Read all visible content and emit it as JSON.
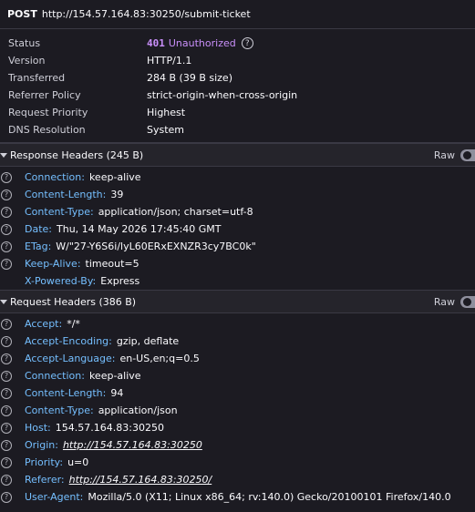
{
  "request": {
    "method": "POST",
    "url": "http://154.57.164.83:30250/submit-ticket"
  },
  "summary": [
    {
      "key": "Status",
      "code": "401",
      "text": "Unauthorized",
      "help": "?"
    },
    {
      "key": "Version",
      "value": "HTTP/1.1"
    },
    {
      "key": "Transferred",
      "value": "284 B (39 B size)"
    },
    {
      "key": "Referrer Policy",
      "value": "strict-origin-when-cross-origin"
    },
    {
      "key": "Request Priority",
      "value": "Highest"
    },
    {
      "key": "DNS Resolution",
      "value": "System"
    }
  ],
  "response_headers": {
    "title": "Response Headers (245 B)",
    "raw_label": "Raw",
    "items": [
      {
        "name": "Connection:",
        "value": "keep-alive",
        "help": true
      },
      {
        "name": "Content-Length:",
        "value": "39",
        "help": true
      },
      {
        "name": "Content-Type:",
        "value": "application/json; charset=utf-8",
        "help": true
      },
      {
        "name": "Date:",
        "value": "Thu, 14 May 2026 17:45:40 GMT",
        "help": true
      },
      {
        "name": "ETag:",
        "value": "W/\"27-Y6S6i/lyL60ERxEXNZR3cy7BC0k\"",
        "help": true
      },
      {
        "name": "Keep-Alive:",
        "value": "timeout=5",
        "help": true
      },
      {
        "name": "X-Powered-By:",
        "value": "Express",
        "help": false
      }
    ]
  },
  "request_headers": {
    "title": "Request Headers (386 B)",
    "raw_label": "Raw",
    "items": [
      {
        "name": "Accept:",
        "value": "*/*",
        "help": true
      },
      {
        "name": "Accept-Encoding:",
        "value": "gzip, deflate",
        "help": true
      },
      {
        "name": "Accept-Language:",
        "value": "en-US,en;q=0.5",
        "help": true
      },
      {
        "name": "Connection:",
        "value": "keep-alive",
        "help": true
      },
      {
        "name": "Content-Length:",
        "value": "94",
        "help": true
      },
      {
        "name": "Content-Type:",
        "value": "application/json",
        "help": true
      },
      {
        "name": "Host:",
        "value": "154.57.164.83:30250",
        "help": true
      },
      {
        "name": "Origin:",
        "value": "http://154.57.164.83:30250",
        "help": true,
        "link": true
      },
      {
        "name": "Priority:",
        "value": "u=0",
        "help": true
      },
      {
        "name": "Referer:",
        "value": "http://154.57.164.83:30250/",
        "help": true,
        "link": true
      },
      {
        "name": "User-Agent:",
        "value": "Mozilla/5.0 (X11; Linux x86_64; rv:140.0) Gecko/20100101 Firefox/140.0",
        "help": true
      }
    ]
  },
  "help_glyph": "?"
}
